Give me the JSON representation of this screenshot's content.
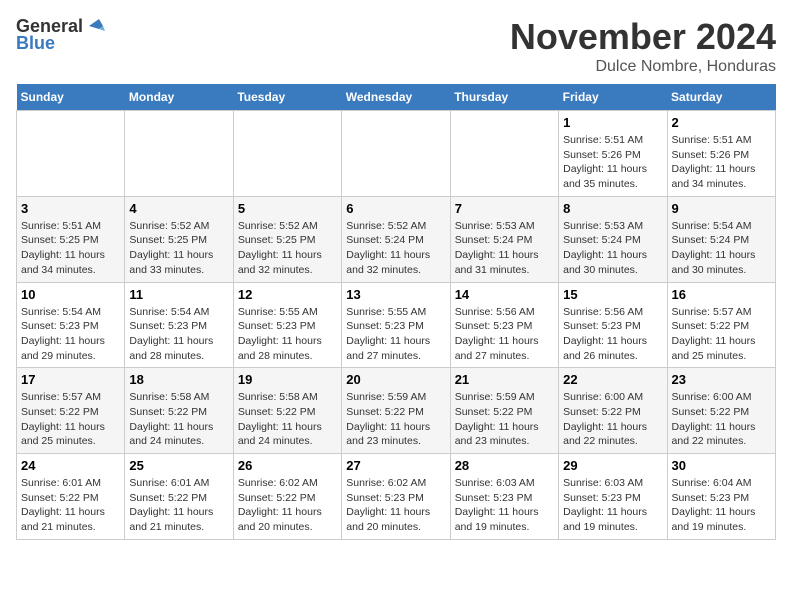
{
  "logo": {
    "line1": "General",
    "line2": "Blue"
  },
  "title": "November 2024",
  "subtitle": "Dulce Nombre, Honduras",
  "days_of_week": [
    "Sunday",
    "Monday",
    "Tuesday",
    "Wednesday",
    "Thursday",
    "Friday",
    "Saturday"
  ],
  "weeks": [
    [
      {
        "day": "",
        "info": ""
      },
      {
        "day": "",
        "info": ""
      },
      {
        "day": "",
        "info": ""
      },
      {
        "day": "",
        "info": ""
      },
      {
        "day": "",
        "info": ""
      },
      {
        "day": "1",
        "info": "Sunrise: 5:51 AM\nSunset: 5:26 PM\nDaylight: 11 hours\nand 35 minutes."
      },
      {
        "day": "2",
        "info": "Sunrise: 5:51 AM\nSunset: 5:26 PM\nDaylight: 11 hours\nand 34 minutes."
      }
    ],
    [
      {
        "day": "3",
        "info": "Sunrise: 5:51 AM\nSunset: 5:25 PM\nDaylight: 11 hours\nand 34 minutes."
      },
      {
        "day": "4",
        "info": "Sunrise: 5:52 AM\nSunset: 5:25 PM\nDaylight: 11 hours\nand 33 minutes."
      },
      {
        "day": "5",
        "info": "Sunrise: 5:52 AM\nSunset: 5:25 PM\nDaylight: 11 hours\nand 32 minutes."
      },
      {
        "day": "6",
        "info": "Sunrise: 5:52 AM\nSunset: 5:24 PM\nDaylight: 11 hours\nand 32 minutes."
      },
      {
        "day": "7",
        "info": "Sunrise: 5:53 AM\nSunset: 5:24 PM\nDaylight: 11 hours\nand 31 minutes."
      },
      {
        "day": "8",
        "info": "Sunrise: 5:53 AM\nSunset: 5:24 PM\nDaylight: 11 hours\nand 30 minutes."
      },
      {
        "day": "9",
        "info": "Sunrise: 5:54 AM\nSunset: 5:24 PM\nDaylight: 11 hours\nand 30 minutes."
      }
    ],
    [
      {
        "day": "10",
        "info": "Sunrise: 5:54 AM\nSunset: 5:23 PM\nDaylight: 11 hours\nand 29 minutes."
      },
      {
        "day": "11",
        "info": "Sunrise: 5:54 AM\nSunset: 5:23 PM\nDaylight: 11 hours\nand 28 minutes."
      },
      {
        "day": "12",
        "info": "Sunrise: 5:55 AM\nSunset: 5:23 PM\nDaylight: 11 hours\nand 28 minutes."
      },
      {
        "day": "13",
        "info": "Sunrise: 5:55 AM\nSunset: 5:23 PM\nDaylight: 11 hours\nand 27 minutes."
      },
      {
        "day": "14",
        "info": "Sunrise: 5:56 AM\nSunset: 5:23 PM\nDaylight: 11 hours\nand 27 minutes."
      },
      {
        "day": "15",
        "info": "Sunrise: 5:56 AM\nSunset: 5:23 PM\nDaylight: 11 hours\nand 26 minutes."
      },
      {
        "day": "16",
        "info": "Sunrise: 5:57 AM\nSunset: 5:22 PM\nDaylight: 11 hours\nand 25 minutes."
      }
    ],
    [
      {
        "day": "17",
        "info": "Sunrise: 5:57 AM\nSunset: 5:22 PM\nDaylight: 11 hours\nand 25 minutes."
      },
      {
        "day": "18",
        "info": "Sunrise: 5:58 AM\nSunset: 5:22 PM\nDaylight: 11 hours\nand 24 minutes."
      },
      {
        "day": "19",
        "info": "Sunrise: 5:58 AM\nSunset: 5:22 PM\nDaylight: 11 hours\nand 24 minutes."
      },
      {
        "day": "20",
        "info": "Sunrise: 5:59 AM\nSunset: 5:22 PM\nDaylight: 11 hours\nand 23 minutes."
      },
      {
        "day": "21",
        "info": "Sunrise: 5:59 AM\nSunset: 5:22 PM\nDaylight: 11 hours\nand 23 minutes."
      },
      {
        "day": "22",
        "info": "Sunrise: 6:00 AM\nSunset: 5:22 PM\nDaylight: 11 hours\nand 22 minutes."
      },
      {
        "day": "23",
        "info": "Sunrise: 6:00 AM\nSunset: 5:22 PM\nDaylight: 11 hours\nand 22 minutes."
      }
    ],
    [
      {
        "day": "24",
        "info": "Sunrise: 6:01 AM\nSunset: 5:22 PM\nDaylight: 11 hours\nand 21 minutes."
      },
      {
        "day": "25",
        "info": "Sunrise: 6:01 AM\nSunset: 5:22 PM\nDaylight: 11 hours\nand 21 minutes."
      },
      {
        "day": "26",
        "info": "Sunrise: 6:02 AM\nSunset: 5:22 PM\nDaylight: 11 hours\nand 20 minutes."
      },
      {
        "day": "27",
        "info": "Sunrise: 6:02 AM\nSunset: 5:23 PM\nDaylight: 11 hours\nand 20 minutes."
      },
      {
        "day": "28",
        "info": "Sunrise: 6:03 AM\nSunset: 5:23 PM\nDaylight: 11 hours\nand 19 minutes."
      },
      {
        "day": "29",
        "info": "Sunrise: 6:03 AM\nSunset: 5:23 PM\nDaylight: 11 hours\nand 19 minutes."
      },
      {
        "day": "30",
        "info": "Sunrise: 6:04 AM\nSunset: 5:23 PM\nDaylight: 11 hours\nand 19 minutes."
      }
    ]
  ]
}
